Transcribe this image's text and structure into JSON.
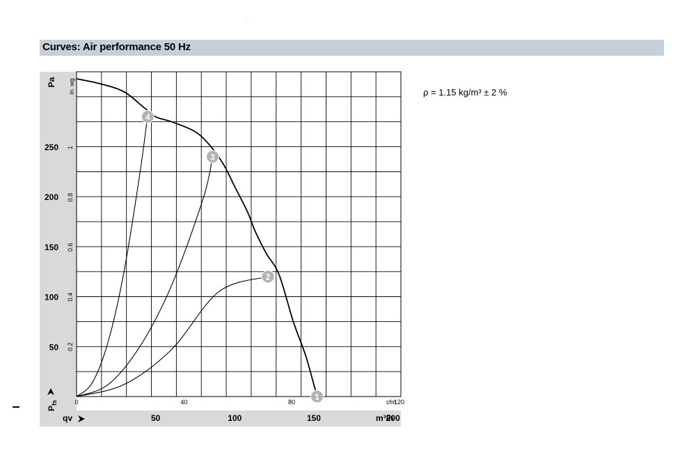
{
  "header": {
    "title": "Curves: Air performance 50 Hz"
  },
  "note": {
    "density": "ρ = 1.15 kg/m³ ± 2 %"
  },
  "page_mark": ".",
  "chart_data": {
    "type": "line",
    "title": "Curves: Air performance 50 Hz",
    "x_axis_primary": {
      "label": "qv",
      "unit": "m³/h",
      "ticks": [
        "50",
        "100",
        "150",
        "200"
      ],
      "range": [
        0,
        205
      ]
    },
    "x_axis_secondary": {
      "unit": "cfm",
      "ticks": [
        "0",
        "40",
        "80",
        "120"
      ]
    },
    "y_axis_primary": {
      "label": "Pfs",
      "unit": "Pa",
      "ticks": [
        "50",
        "100",
        "150",
        "200",
        "250"
      ],
      "range": [
        0,
        325
      ]
    },
    "y_axis_secondary": {
      "unit": "in. wg",
      "ticks": [
        "0.2",
        "0.4",
        "0.6",
        "0.8",
        "1"
      ]
    },
    "grid": true,
    "series": [
      {
        "name": "",
        "role": "fan-curve",
        "x": [
          0,
          15,
          30,
          42,
          50,
          60,
          75,
          85,
          93,
          100,
          108,
          113,
          120,
          128,
          137,
          145,
          152
        ],
        "y": [
          318,
          313,
          305,
          290,
          280,
          275,
          265,
          250,
          232,
          210,
          185,
          165,
          143,
          122,
          75,
          40,
          0
        ]
      },
      {
        "name": "",
        "role": "system-curve",
        "x": [
          0,
          10,
          20,
          30,
          40,
          45
        ],
        "y": [
          0,
          14,
          55,
          125,
          223,
          282
        ]
      },
      {
        "name": "",
        "role": "system-curve",
        "x": [
          0,
          20,
          40,
          60,
          80,
          86
        ],
        "y": [
          0,
          12,
          50,
          111,
          198,
          240
        ]
      },
      {
        "name": "",
        "role": "system-curve",
        "x": [
          0,
          30,
          60,
          90,
          121
        ],
        "y": [
          0,
          12,
          47,
          105,
          120
        ]
      }
    ],
    "operating_points": [
      {
        "label": "1",
        "x": 152,
        "y": 0
      },
      {
        "label": "2",
        "x": 121,
        "y": 120
      },
      {
        "label": "3",
        "x": 86,
        "y": 240
      },
      {
        "label": "4",
        "x": 45,
        "y": 280
      }
    ]
  }
}
